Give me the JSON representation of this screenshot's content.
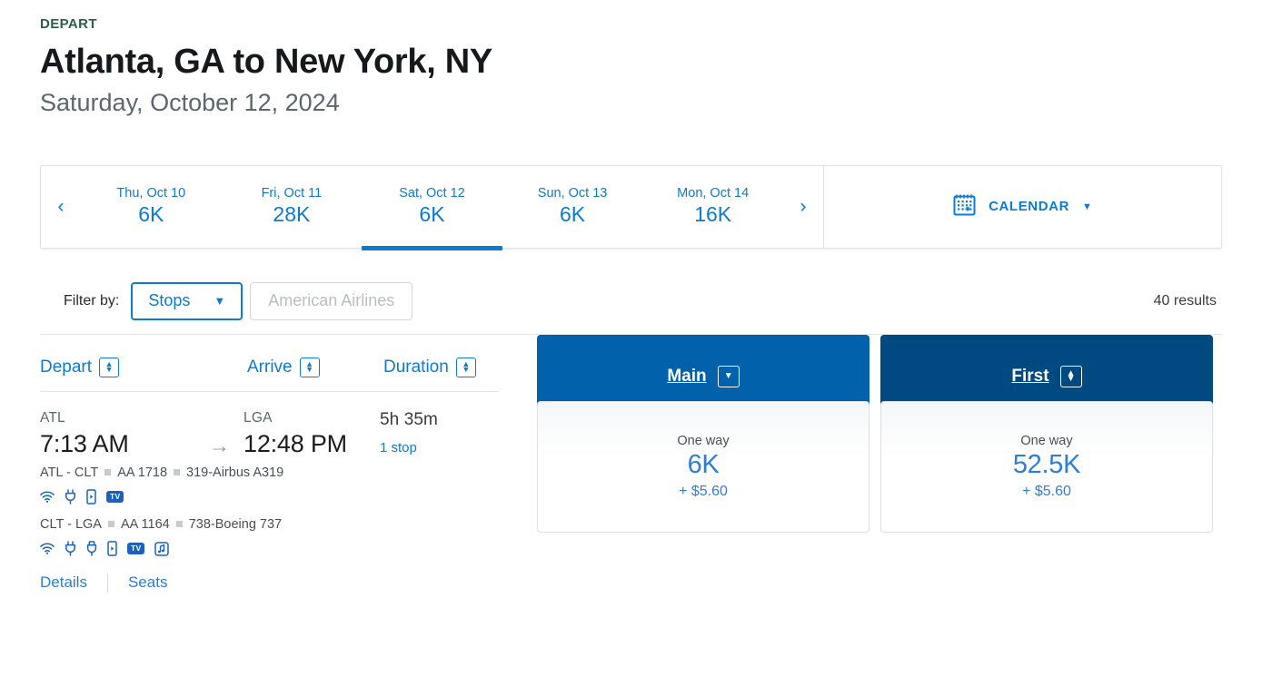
{
  "header": {
    "eyebrow": "DEPART",
    "route": "Atlanta, GA to New York, NY",
    "date": "Saturday, October 12, 2024"
  },
  "datebar": {
    "prev_label": "‹",
    "next_label": "›",
    "days": [
      {
        "label": "Thu, Oct 10",
        "price": "6K",
        "active": false
      },
      {
        "label": "Fri, Oct 11",
        "price": "28K",
        "active": false
      },
      {
        "label": "Sat, Oct 12",
        "price": "6K",
        "active": true
      },
      {
        "label": "Sun, Oct 13",
        "price": "6K",
        "active": false
      },
      {
        "label": "Mon, Oct 14",
        "price": "16K",
        "active": false
      }
    ],
    "calendar_label": "CALENDAR",
    "calendar_caret": "▼"
  },
  "filters": {
    "label": "Filter by:",
    "stops_label": "Stops",
    "stops_caret": "▼",
    "airline_label": "American Airlines",
    "results": "40 results"
  },
  "columns": {
    "depart": "Depart",
    "arrive": "Arrive",
    "duration": "Duration"
  },
  "fares": [
    {
      "name": "Main",
      "caret": "▼",
      "has_up": false,
      "color": "#0261ab"
    },
    {
      "name": "First",
      "caret": "▼",
      "has_up": true,
      "color": "#004a82"
    }
  ],
  "flight": {
    "depart_airport": "ATL",
    "depart_time": "7:13 AM",
    "arrive_airport": "LGA",
    "arrive_time": "12:48 PM",
    "duration": "5h 35m",
    "stops": "1 stop",
    "segments": [
      {
        "route": "ATL - CLT",
        "flight_no": "AA 1718",
        "aircraft": "319-Airbus A319",
        "amenities": [
          "wifi-icon",
          "power-icon",
          "device-icon",
          "tv-icon"
        ]
      },
      {
        "route": "CLT - LGA",
        "flight_no": "AA 1164",
        "aircraft": "738-Boeing 737",
        "amenities": [
          "wifi-icon",
          "power-icon",
          "usb-icon",
          "device-icon",
          "tv-icon",
          "music-icon"
        ]
      }
    ],
    "prices": [
      {
        "label": "One way",
        "miles": "6K",
        "fee": "+ $5.60"
      },
      {
        "label": "One way",
        "miles": "52.5K",
        "fee": "+ $5.60"
      }
    ],
    "details_link": "Details",
    "seats_link": "Seats"
  },
  "colors": {
    "accent_blue": "#0c7bd1",
    "main_blue": "#0261ab",
    "first_navy": "#004a82",
    "eyebrow_green": "#2a6046"
  }
}
